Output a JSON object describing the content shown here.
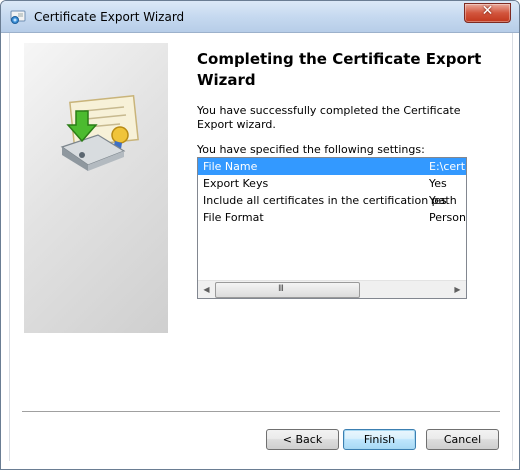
{
  "window": {
    "title": "Certificate Export Wizard",
    "close_label": "✕"
  },
  "main": {
    "heading": "Completing the Certificate Export Wizard",
    "description": "You have successfully completed the Certificate Export wizard.",
    "settings_label": "You have specified the following settings:",
    "settings": [
      {
        "name": "File Name",
        "value": "E:\\cert"
      },
      {
        "name": "Export Keys",
        "value": "Yes"
      },
      {
        "name": "Include all certificates in the certification path",
        "value": "Yes"
      },
      {
        "name": "File Format",
        "value": "Person"
      }
    ],
    "scrollbar_grip": "III"
  },
  "buttons": {
    "back": "< Back",
    "finish": "Finish",
    "cancel": "Cancel"
  }
}
